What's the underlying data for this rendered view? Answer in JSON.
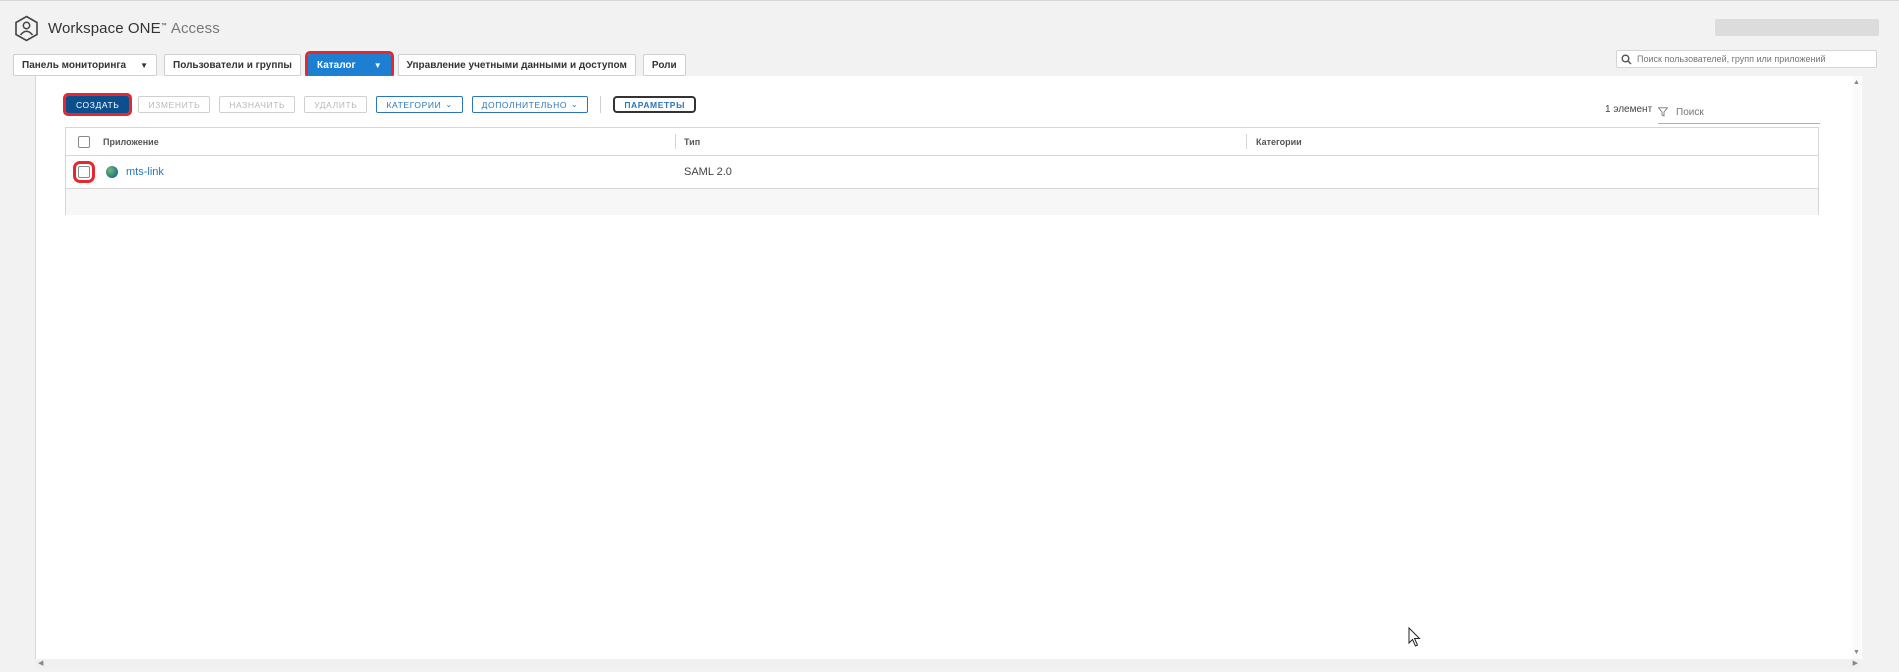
{
  "header": {
    "product_name": "Workspace ONE",
    "product_suffix": "Access",
    "logo_icon": "hexagon-person-logo"
  },
  "nav": {
    "tabs": [
      {
        "label": "Панель мониторинга",
        "has_dropdown": true,
        "active": false
      },
      {
        "label": "Пользователи и группы",
        "has_dropdown": false,
        "active": false
      },
      {
        "label": "Каталог",
        "has_dropdown": true,
        "active": true
      },
      {
        "label": "Управление учетными данными и доступом",
        "has_dropdown": false,
        "active": false
      },
      {
        "label": "Роли",
        "has_dropdown": false,
        "active": false
      }
    ],
    "search_placeholder": "Поиск пользователей, групп или приложений"
  },
  "toolbar": {
    "create_label": "СОЗДАТЬ",
    "edit_label": "ИЗМЕНИТЬ",
    "assign_label": "НАЗНАЧИТЬ",
    "delete_label": "УДАЛИТЬ",
    "categories_label": "КАТЕГОРИИ",
    "more_label": "ДОПОЛНИТЕЛЬНО",
    "settings_label": "ПАРАМЕТРЫ"
  },
  "list": {
    "item_count": "1 элемент",
    "filter_placeholder": "Поиск",
    "columns": {
      "app": "Приложение",
      "type": "Тип",
      "categories": "Категории"
    },
    "rows": [
      {
        "name": "mts-link",
        "type": "SAML 2.0",
        "categories": ""
      }
    ]
  },
  "colors": {
    "primary": "#0b4f8f",
    "active_tab": "#1c7fd1",
    "link": "#2b76b9",
    "highlight": "#e8262d"
  }
}
